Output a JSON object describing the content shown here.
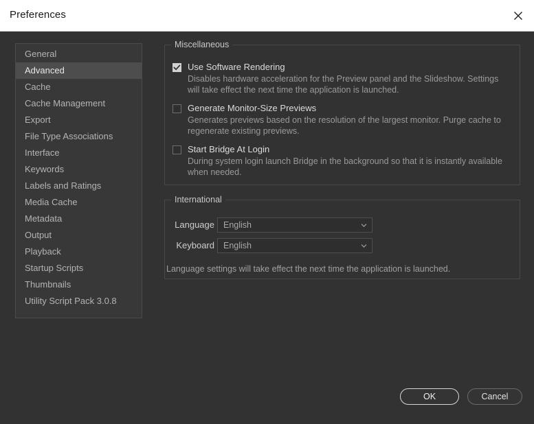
{
  "window": {
    "title": "Preferences",
    "close_icon": "close-icon"
  },
  "sidebar": {
    "items": [
      {
        "label": "General",
        "selected": false
      },
      {
        "label": "Advanced",
        "selected": true
      },
      {
        "label": "Cache",
        "selected": false
      },
      {
        "label": "Cache Management",
        "selected": false
      },
      {
        "label": "Export",
        "selected": false
      },
      {
        "label": "File Type Associations",
        "selected": false
      },
      {
        "label": "Interface",
        "selected": false
      },
      {
        "label": "Keywords",
        "selected": false
      },
      {
        "label": "Labels and Ratings",
        "selected": false
      },
      {
        "label": "Media Cache",
        "selected": false
      },
      {
        "label": "Metadata",
        "selected": false
      },
      {
        "label": "Output",
        "selected": false
      },
      {
        "label": "Playback",
        "selected": false
      },
      {
        "label": "Startup Scripts",
        "selected": false
      },
      {
        "label": "Thumbnails",
        "selected": false
      },
      {
        "label": "Utility Script Pack 3.0.8",
        "selected": false
      }
    ]
  },
  "miscellaneous": {
    "legend": "Miscellaneous",
    "options": [
      {
        "label": "Use Software Rendering",
        "checked": true,
        "description": "Disables hardware acceleration for the Preview panel and the Slideshow. Settings will take effect the next time the application is launched."
      },
      {
        "label": "Generate Monitor-Size Previews",
        "checked": false,
        "description": "Generates previews based on the resolution of the largest monitor. Purge cache to regenerate existing previews."
      },
      {
        "label": "Start Bridge At Login",
        "checked": false,
        "description": "During system login launch Bridge in the background so that it is instantly available when needed."
      }
    ]
  },
  "international": {
    "legend": "International",
    "fields": [
      {
        "label": "Language",
        "value": "English",
        "arrow_icon": "chevron-down-icon"
      },
      {
        "label": "Keyboard",
        "value": "English",
        "arrow_icon": "chevron-down-icon"
      }
    ],
    "note": "Language settings will take effect the next time the application is launched."
  },
  "footer": {
    "ok_label": "OK",
    "cancel_label": "Cancel"
  },
  "colors": {
    "dialog_background": "#323232",
    "titlebar_background": "#ffffff",
    "selection": "#4d4d4d",
    "text_primary": "#dcdcdc",
    "text_secondary": "#9a9a9a",
    "border": "#484848"
  }
}
